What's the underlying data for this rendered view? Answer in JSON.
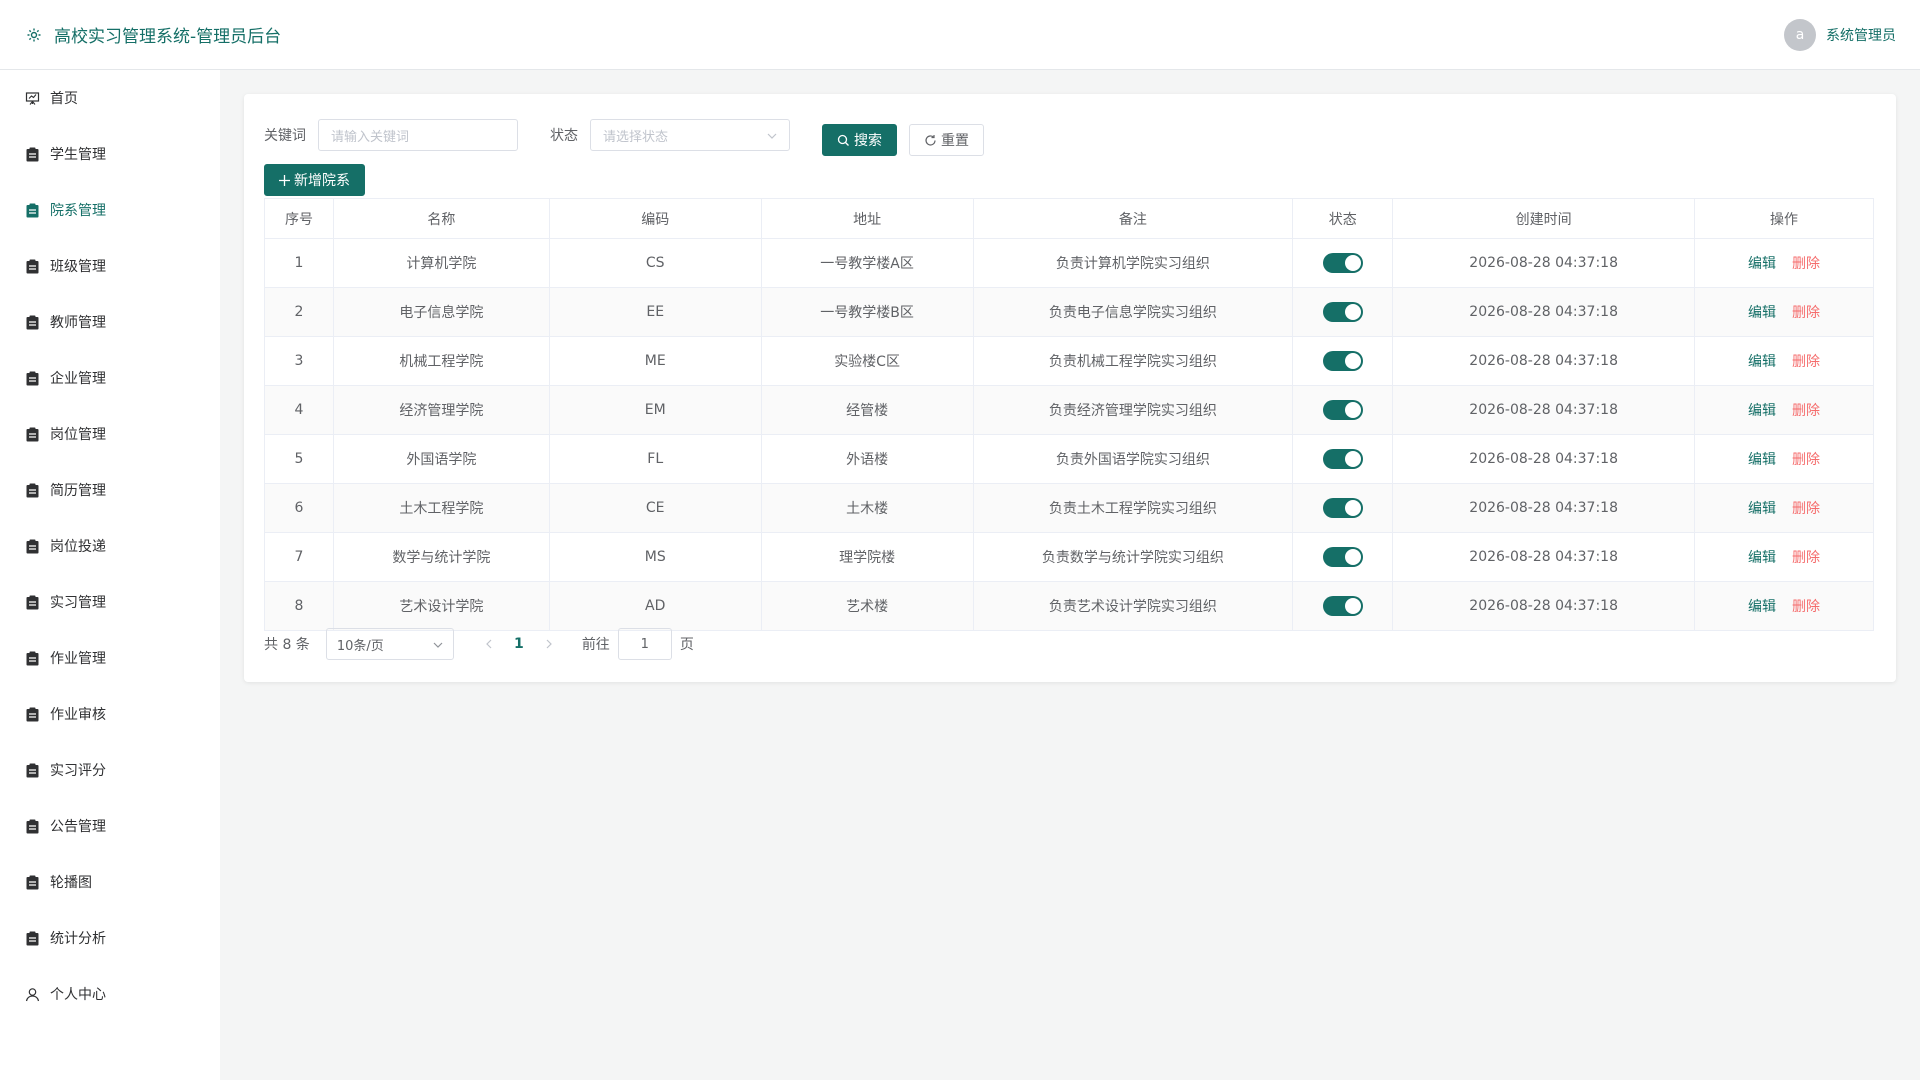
{
  "header": {
    "title": "高校实习管理系统-管理员后台",
    "avatar_letter": "a",
    "username": "系统管理员"
  },
  "sidebar": {
    "items": [
      {
        "label": "首页",
        "icon": "presentation-icon",
        "active": false
      },
      {
        "label": "学生管理",
        "icon": "clipboard-icon",
        "active": false
      },
      {
        "label": "院系管理",
        "icon": "clipboard-icon",
        "active": true
      },
      {
        "label": "班级管理",
        "icon": "clipboard-icon",
        "active": false
      },
      {
        "label": "教师管理",
        "icon": "clipboard-icon",
        "active": false
      },
      {
        "label": "企业管理",
        "icon": "clipboard-icon",
        "active": false
      },
      {
        "label": "岗位管理",
        "icon": "clipboard-icon",
        "active": false
      },
      {
        "label": "简历管理",
        "icon": "clipboard-icon",
        "active": false
      },
      {
        "label": "岗位投递",
        "icon": "clipboard-icon",
        "active": false
      },
      {
        "label": "实习管理",
        "icon": "clipboard-icon",
        "active": false
      },
      {
        "label": "作业管理",
        "icon": "clipboard-icon",
        "active": false
      },
      {
        "label": "作业审核",
        "icon": "clipboard-icon",
        "active": false
      },
      {
        "label": "实习评分",
        "icon": "clipboard-icon",
        "active": false
      },
      {
        "label": "公告管理",
        "icon": "clipboard-icon",
        "active": false
      },
      {
        "label": "轮播图",
        "icon": "clipboard-icon",
        "active": false
      },
      {
        "label": "统计分析",
        "icon": "clipboard-icon",
        "active": false
      },
      {
        "label": "个人中心",
        "icon": "user-icon",
        "active": false
      }
    ]
  },
  "filters": {
    "keyword_label": "关键词",
    "keyword_placeholder": "请输入关键词",
    "status_label": "状态",
    "status_placeholder": "请选择状态",
    "search_label": "搜索",
    "reset_label": "重置",
    "add_label": "新增院系"
  },
  "table": {
    "headers": [
      "序号",
      "名称",
      "编码",
      "地址",
      "备注",
      "状态",
      "创建时间",
      "操作"
    ],
    "edit_label": "编辑",
    "delete_label": "删除",
    "rows": [
      {
        "no": "1",
        "name": "计算机学院",
        "code": "CS",
        "address": "一号教学楼A区",
        "remark": "负责计算机学院实习组织",
        "status": true,
        "created": "2026-08-28 04:37:18"
      },
      {
        "no": "2",
        "name": "电子信息学院",
        "code": "EE",
        "address": "一号教学楼B区",
        "remark": "负责电子信息学院实习组织",
        "status": true,
        "created": "2026-08-28 04:37:18"
      },
      {
        "no": "3",
        "name": "机械工程学院",
        "code": "ME",
        "address": "实验楼C区",
        "remark": "负责机械工程学院实习组织",
        "status": true,
        "created": "2026-08-28 04:37:18"
      },
      {
        "no": "4",
        "name": "经济管理学院",
        "code": "EM",
        "address": "经管楼",
        "remark": "负责经济管理学院实习组织",
        "status": true,
        "created": "2026-08-28 04:37:18"
      },
      {
        "no": "5",
        "name": "外国语学院",
        "code": "FL",
        "address": "外语楼",
        "remark": "负责外国语学院实习组织",
        "status": true,
        "created": "2026-08-28 04:37:18"
      },
      {
        "no": "6",
        "name": "土木工程学院",
        "code": "CE",
        "address": "土木楼",
        "remark": "负责土木工程学院实习组织",
        "status": true,
        "created": "2026-08-28 04:37:18"
      },
      {
        "no": "7",
        "name": "数学与统计学院",
        "code": "MS",
        "address": "理学院楼",
        "remark": "负责数学与统计学院实习组织",
        "status": true,
        "created": "2026-08-28 04:37:18"
      },
      {
        "no": "8",
        "name": "艺术设计学院",
        "code": "AD",
        "address": "艺术楼",
        "remark": "负责艺术设计学院实习组织",
        "status": true,
        "created": "2026-08-28 04:37:18"
      }
    ]
  },
  "pagination": {
    "total_text": "共 8 条",
    "page_size": "10条/页",
    "current_page": "1",
    "goto_label": "前往",
    "goto_value": "1",
    "page_suffix": "页"
  },
  "colors": {
    "primary": "#156f67",
    "danger": "#f56c6c"
  }
}
